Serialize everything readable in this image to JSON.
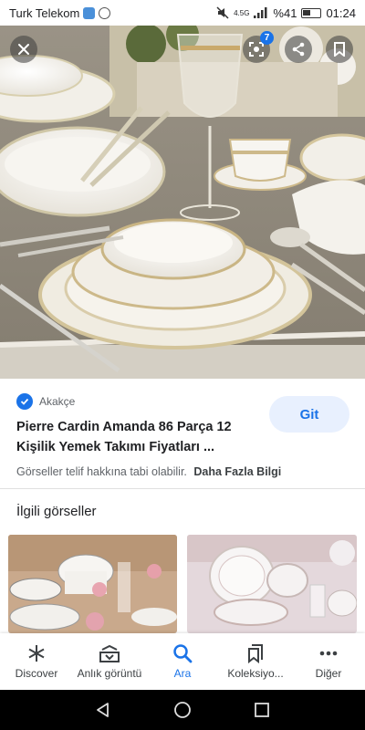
{
  "status_bar": {
    "carrier": "Turk Telekom",
    "network": "4.5G",
    "battery_pct": "%41",
    "time": "01:24"
  },
  "hero": {
    "lens_count": "7",
    "icons": [
      "close-icon",
      "lens-icon",
      "share-icon",
      "bookmark-icon"
    ]
  },
  "result": {
    "source": "Akakçe",
    "title": "Pierre Cardin Amanda 86 Parça 12 Kişilik Yemek Takımı Fiyatları ...",
    "visit_label": "Git",
    "copyright_text": "Görseller telif hakkına tabi olabilir.",
    "more_info_label": "Daha Fazla Bilgi"
  },
  "related": {
    "title": "İlgili görseller"
  },
  "bottom_nav": {
    "items": [
      {
        "label": "Discover",
        "icon": "asterisk-icon"
      },
      {
        "label": "Anlık görüntü",
        "icon": "snapshot-icon"
      },
      {
        "label": "Ara",
        "icon": "search-icon"
      },
      {
        "label": "Koleksiyo...",
        "icon": "collections-icon"
      },
      {
        "label": "Diğer",
        "icon": "more-icon"
      }
    ],
    "active_index": 2
  },
  "colors": {
    "accent": "#1a73e8",
    "button_bg": "#e8f0fe",
    "text_primary": "#202124",
    "text_secondary": "#5f6368"
  }
}
